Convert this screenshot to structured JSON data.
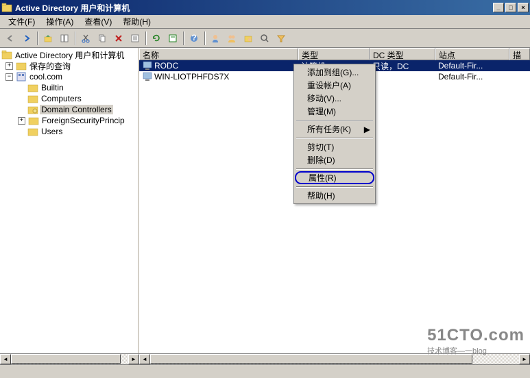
{
  "window": {
    "title": "Active Directory 用户和计算机",
    "btn_min": "_",
    "btn_max": "□",
    "btn_close": "×"
  },
  "menus": {
    "file": "文件(F)",
    "action": "操作(A)",
    "view": "查看(V)",
    "help": "帮助(H)"
  },
  "tree": {
    "root": "Active Directory 用户和计算机",
    "saved_queries": "保存的查询",
    "domain": "cool.com",
    "builtin": "Builtin",
    "computers": "Computers",
    "domain_controllers": "Domain Controllers",
    "fsp": "ForeignSecurityPrincip",
    "users": "Users"
  },
  "columns": {
    "name": "名称",
    "type": "类型",
    "dc_type": "DC 类型",
    "site": "站点",
    "desc": "描"
  },
  "col_widths": {
    "name": 232,
    "type": 104,
    "dc_type": 96,
    "site": 108,
    "desc": 28
  },
  "rows": [
    {
      "name": "RODC",
      "type": "计算机",
      "dc_type": "只读，DC",
      "site": "Default-Fir...",
      "selected": true
    },
    {
      "name": "WIN-LIOTPHFDS7X",
      "type": "",
      "dc_type": "",
      "site": "Default-Fir...",
      "selected": false
    }
  ],
  "context_menu": {
    "add_to_group": "添加到组(G)...",
    "reset_account": "重设帐户(A)",
    "move": "移动(V)...",
    "manage": "管理(M)",
    "all_tasks": "所有任务(K)",
    "cut": "剪切(T)",
    "delete": "删除(D)",
    "properties": "属性(R)",
    "help": "帮助(H)"
  },
  "watermark": {
    "big": "51CTO.com",
    "small": "技术博客—一blog"
  }
}
